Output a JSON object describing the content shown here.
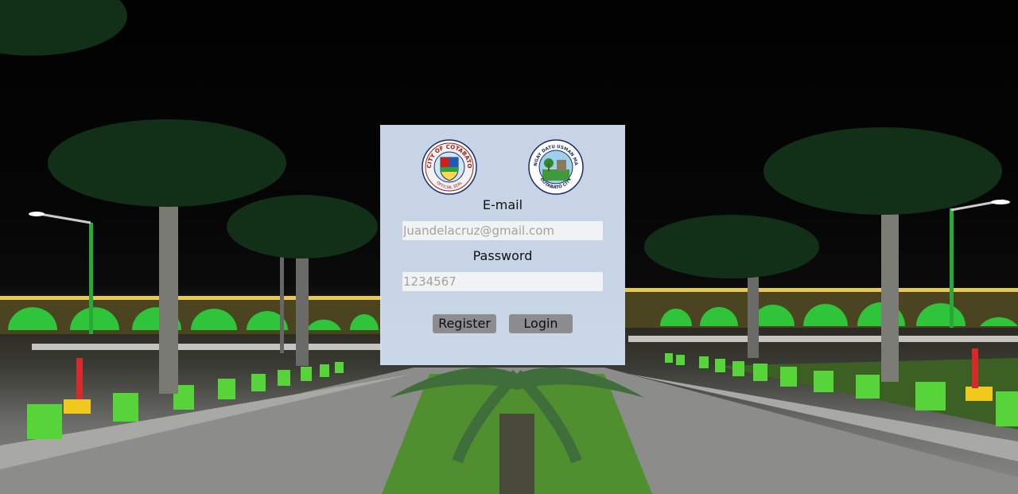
{
  "logos": {
    "city_seal": {
      "icon": "city-of-cotabato-seal-icon",
      "top_text": "CITY OF COTABATO",
      "bottom_text": "OFFICIAL SEAL"
    },
    "barangay_seal": {
      "icon": "barangay-datu-usman-seal-icon",
      "top_text": "BARANGAY DATU USMAN MAMPEN",
      "bottom_text": "COTABATO CITY"
    }
  },
  "form": {
    "email_label": "E-mail",
    "email_placeholder": "Juandelacruz@gmail.com",
    "email_value": "",
    "password_label": "Password",
    "password_placeholder": "1234567",
    "password_value": "",
    "register_label": "Register",
    "login_label": "Login"
  },
  "colors": {
    "panel_background": "#d6e4f6",
    "button_background": "#8d8d8f",
    "accent_green": "#3fd13a"
  }
}
